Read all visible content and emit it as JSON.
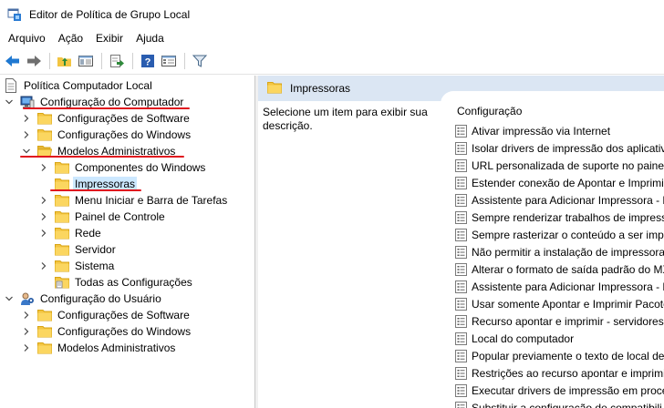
{
  "window": {
    "title": "Editor de Política de Grupo Local"
  },
  "menu": [
    "Arquivo",
    "Ação",
    "Exibir",
    "Ajuda"
  ],
  "toolbar": {
    "buttons": [
      "back-arrow-icon",
      "forward-arrow-icon",
      "folder-up-icon",
      "show-hide-tree-icon",
      "export-list-icon",
      "help-icon",
      "properties-view-icon",
      "filter-icon"
    ]
  },
  "tree": {
    "root": "Política Computador Local",
    "computer_config": "Configuração do Computador",
    "cc_software": "Configurações de Software",
    "cc_windows": "Configurações do Windows",
    "cc_admin": "Modelos Administrativos",
    "admin_children": [
      "Componentes do Windows",
      "Impressoras",
      "Menu Iniciar e Barra de Tarefas",
      "Painel de Controle",
      "Rede",
      "Servidor",
      "Sistema",
      "Todas as Configurações"
    ],
    "user_config": "Configuração do Usuário",
    "uc_software": "Configurações de Software",
    "uc_windows": "Configurações do Windows",
    "uc_admin": "Modelos Administrativos"
  },
  "right": {
    "header_title": "Impressoras",
    "description": "Selecione um item para exibir sua descrição.",
    "column_header": "Configuração",
    "settings": [
      "Ativar impressão via Internet",
      "Isolar drivers de impressão dos aplicativos",
      "URL personalizada de suporte no painel",
      "Estender conexão de Apontar e Imprimir",
      "Assistente para Adicionar Impressora - P",
      "Sempre renderizar trabalhos de impressão",
      "Sempre rasterizar o conteúdo a ser impr",
      "Não permitir a instalação de impressoras",
      "Alterar o formato de saída padrão do MX",
      "Assistente para Adicionar Impressora - P",
      "Usar somente Apontar e Imprimir Pacote",
      "Recurso apontar e imprimir - servidores",
      "Local do computador",
      "Popular previamente o texto de local de",
      "Restrições ao recurso apontar e imprimir",
      "Executar drivers de impressão em proce",
      "Substituir a configuração de compatibili"
    ]
  },
  "colors": {
    "annotation": "#e0141e",
    "selection": "#cce8ff",
    "header_bg": "#dbe6f3",
    "folder": "#f3c542"
  }
}
